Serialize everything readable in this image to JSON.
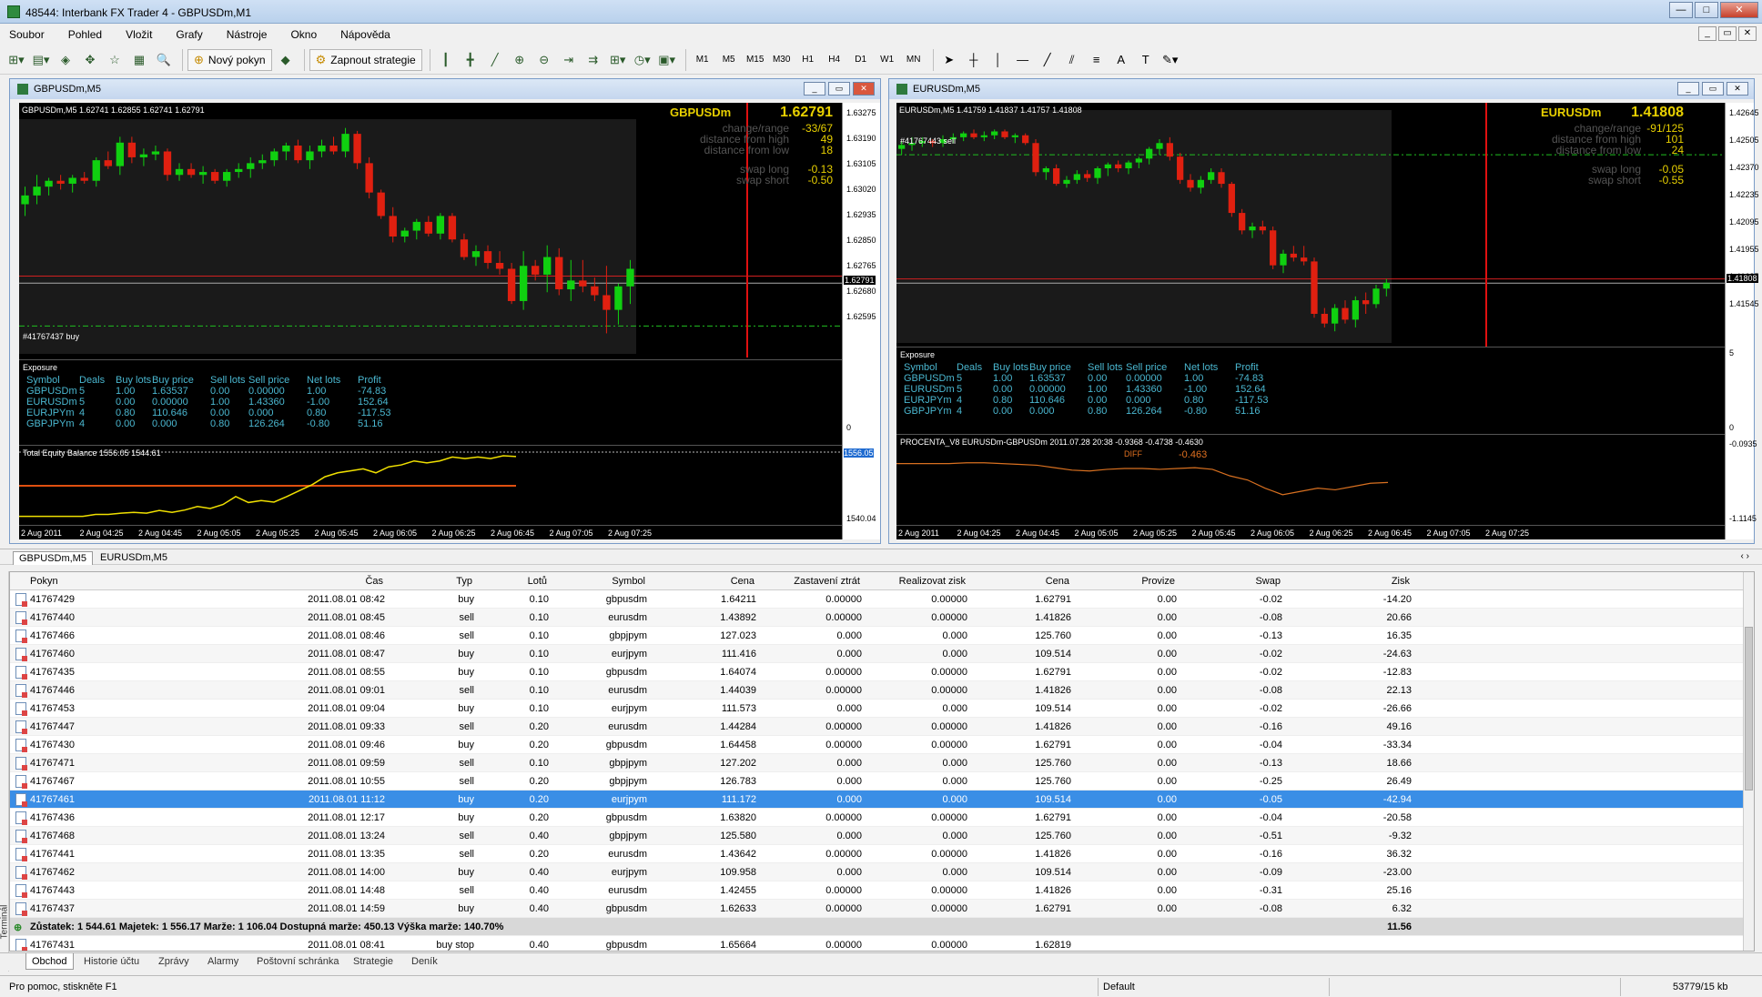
{
  "window": {
    "title": "48544: Interbank FX Trader 4 - GBPUSDm,M1"
  },
  "menu": [
    "Soubor",
    "Pohled",
    "Vložit",
    "Grafy",
    "Nástroje",
    "Okno",
    "Nápověda"
  ],
  "toolbar": {
    "new_order": "Nový pokyn",
    "expert": "Zapnout strategie",
    "timeframes": [
      "M1",
      "M5",
      "M15",
      "M30",
      "H1",
      "H4",
      "D1",
      "W1",
      "MN"
    ]
  },
  "chart1": {
    "title": "GBPUSDm,M5",
    "ohlc": "GBPUSDm,M5  1.62741 1.62855 1.62741 1.62791",
    "symbol": "GBPUSDm",
    "price": "1.62791",
    "order_label": "#41767437 buy",
    "info": [
      [
        "change/range",
        "-33/67"
      ],
      [
        "distance from high",
        "49"
      ],
      [
        "distance from low",
        "18"
      ],
      [
        "swap long",
        "-0.13"
      ],
      [
        "swap short",
        "-0.50"
      ]
    ],
    "yticks": [
      "1.63275",
      "1.63190",
      "1.63105",
      "1.63020",
      "1.62935",
      "1.62850",
      "1.62765",
      "1.62680",
      "1.62595"
    ],
    "yprice_tag": "1.62791",
    "equity_label": "Total Equity Balance 1556.05 1544.61",
    "equity_tag": "1556.05",
    "equity_low": "1540.04",
    "xticks": [
      "2 Aug 2011",
      "2 Aug 04:25",
      "2 Aug 04:45",
      "2 Aug 05:05",
      "2 Aug 05:25",
      "2 Aug 05:45",
      "2 Aug 06:05",
      "2 Aug 06:25",
      "2 Aug 06:45",
      "2 Aug 07:05",
      "2 Aug 07:25"
    ]
  },
  "chart2": {
    "title": "EURUSDm,M5",
    "ohlc": "EURUSDm,M5  1.41759 1.41837 1.41757 1.41808",
    "symbol": "EURUSDm",
    "price": "1.41808",
    "order_label": "#41767443 sell",
    "info": [
      [
        "change/range",
        "-91/125"
      ],
      [
        "distance from high",
        "101"
      ],
      [
        "distance from low",
        "24"
      ],
      [
        "swap long",
        "-0.05"
      ],
      [
        "swap short",
        "-0.55"
      ]
    ],
    "yticks": [
      "1.42645",
      "1.42505",
      "1.42370",
      "1.42235",
      "1.42095",
      "1.41955",
      "1.41685",
      "1.41545"
    ],
    "yprice_tag": "1.41808",
    "indicator_label": "PROCENTA_V8 EURUSDm-GBPUSDm 2011.07.28 20:38  -0.9368 -0.4738 -0.4630",
    "diff_label": "DIFF",
    "diff_value": "-0.463",
    "ind_top": "-0.0935",
    "ind_bottom": "-1.1145",
    "exp_zero": "0",
    "exp_top": "5",
    "xticks": [
      "2 Aug 2011",
      "2 Aug 04:25",
      "2 Aug 04:45",
      "2 Aug 05:05",
      "2 Aug 05:25",
      "2 Aug 05:45",
      "2 Aug 06:05",
      "2 Aug 06:25",
      "2 Aug 06:45",
      "2 Aug 07:05",
      "2 Aug 07:25"
    ]
  },
  "exposure": {
    "title": "Exposure",
    "headers": [
      "Symbol",
      "Deals",
      "Buy lots",
      "Buy price",
      "Sell lots",
      "Sell price",
      "Net lots",
      "Profit"
    ],
    "rows1": [
      [
        "GBPUSDm",
        "5",
        "1.00",
        "1.63537",
        "0.00",
        "0.00000",
        "1.00",
        "-74.83"
      ],
      [
        "EURUSDm",
        "5",
        "0.00",
        "0.00000",
        "1.00",
        "1.43360",
        "-1.00",
        "152.64"
      ],
      [
        "EURJPYm",
        "4",
        "0.80",
        "110.646",
        "0.00",
        "0.000",
        "0.80",
        "-117.53"
      ],
      [
        "GBPJPYm",
        "4",
        "0.00",
        "0.000",
        "0.80",
        "126.264",
        "-0.80",
        "51.16"
      ]
    ],
    "rows2": [
      [
        "GBPUSDm",
        "5",
        "1.00",
        "1.63537",
        "0.00",
        "0.00000",
        "1.00",
        "-74.83"
      ],
      [
        "EURUSDm",
        "5",
        "0.00",
        "0.00000",
        "1.00",
        "1.43360",
        "-1.00",
        "152.64"
      ],
      [
        "EURJPYm",
        "4",
        "0.80",
        "110.646",
        "0.00",
        "0.000",
        "0.80",
        "-117.53"
      ],
      [
        "GBPJPYm",
        "4",
        "0.00",
        "0.000",
        "0.80",
        "126.264",
        "-0.80",
        "51.16"
      ]
    ],
    "zero": "0"
  },
  "chart_tabs": [
    "GBPUSDm,M5",
    "EURUSDm,M5"
  ],
  "terminal": {
    "headers": [
      "Pokyn",
      "Čas",
      "Typ",
      "Lotů",
      "Symbol",
      "Cena",
      "Zastavení ztrát",
      "Realizovat zisk",
      "Cena",
      "Provize",
      "Swap",
      "Zisk"
    ],
    "rows": [
      [
        "41767429",
        "2011.08.01 08:42",
        "buy",
        "0.10",
        "gbpusdm",
        "1.64211",
        "0.00000",
        "0.00000",
        "1.62791",
        "0.00",
        "-0.02",
        "-14.20"
      ],
      [
        "41767440",
        "2011.08.01 08:45",
        "sell",
        "0.10",
        "eurusdm",
        "1.43892",
        "0.00000",
        "0.00000",
        "1.41826",
        "0.00",
        "-0.08",
        "20.66"
      ],
      [
        "41767466",
        "2011.08.01 08:46",
        "sell",
        "0.10",
        "gbpjpym",
        "127.023",
        "0.000",
        "0.000",
        "125.760",
        "0.00",
        "-0.13",
        "16.35"
      ],
      [
        "41767460",
        "2011.08.01 08:47",
        "buy",
        "0.10",
        "eurjpym",
        "111.416",
        "0.000",
        "0.000",
        "109.514",
        "0.00",
        "-0.02",
        "-24.63"
      ],
      [
        "41767435",
        "2011.08.01 08:55",
        "buy",
        "0.10",
        "gbpusdm",
        "1.64074",
        "0.00000",
        "0.00000",
        "1.62791",
        "0.00",
        "-0.02",
        "-12.83"
      ],
      [
        "41767446",
        "2011.08.01 09:01",
        "sell",
        "0.10",
        "eurusdm",
        "1.44039",
        "0.00000",
        "0.00000",
        "1.41826",
        "0.00",
        "-0.08",
        "22.13"
      ],
      [
        "41767453",
        "2011.08.01 09:04",
        "buy",
        "0.10",
        "eurjpym",
        "111.573",
        "0.000",
        "0.000",
        "109.514",
        "0.00",
        "-0.02",
        "-26.66"
      ],
      [
        "41767447",
        "2011.08.01 09:33",
        "sell",
        "0.20",
        "eurusdm",
        "1.44284",
        "0.00000",
        "0.00000",
        "1.41826",
        "0.00",
        "-0.16",
        "49.16"
      ],
      [
        "41767430",
        "2011.08.01 09:46",
        "buy",
        "0.20",
        "gbpusdm",
        "1.64458",
        "0.00000",
        "0.00000",
        "1.62791",
        "0.00",
        "-0.04",
        "-33.34"
      ],
      [
        "41767471",
        "2011.08.01 09:59",
        "sell",
        "0.10",
        "gbpjpym",
        "127.202",
        "0.000",
        "0.000",
        "125.760",
        "0.00",
        "-0.13",
        "18.66"
      ],
      [
        "41767467",
        "2011.08.01 10:55",
        "sell",
        "0.20",
        "gbpjpym",
        "126.783",
        "0.000",
        "0.000",
        "125.760",
        "0.00",
        "-0.25",
        "26.49"
      ],
      [
        "41767461",
        "2011.08.01 11:12",
        "buy",
        "0.20",
        "eurjpym",
        "111.172",
        "0.000",
        "0.000",
        "109.514",
        "0.00",
        "-0.05",
        "-42.94"
      ],
      [
        "41767436",
        "2011.08.01 12:17",
        "buy",
        "0.20",
        "gbpusdm",
        "1.63820",
        "0.00000",
        "0.00000",
        "1.62791",
        "0.00",
        "-0.04",
        "-20.58"
      ],
      [
        "41767468",
        "2011.08.01 13:24",
        "sell",
        "0.40",
        "gbpjpym",
        "125.580",
        "0.000",
        "0.000",
        "125.760",
        "0.00",
        "-0.51",
        "-9.32"
      ],
      [
        "41767441",
        "2011.08.01 13:35",
        "sell",
        "0.20",
        "eurusdm",
        "1.43642",
        "0.00000",
        "0.00000",
        "1.41826",
        "0.00",
        "-0.16",
        "36.32"
      ],
      [
        "41767462",
        "2011.08.01 14:00",
        "buy",
        "0.40",
        "eurjpym",
        "109.958",
        "0.000",
        "0.000",
        "109.514",
        "0.00",
        "-0.09",
        "-23.00"
      ],
      [
        "41767443",
        "2011.08.01 14:48",
        "sell",
        "0.40",
        "eurusdm",
        "1.42455",
        "0.00000",
        "0.00000",
        "1.41826",
        "0.00",
        "-0.31",
        "25.16"
      ],
      [
        "41767437",
        "2011.08.01 14:59",
        "buy",
        "0.40",
        "gbpusdm",
        "1.62633",
        "0.00000",
        "0.00000",
        "1.62791",
        "0.00",
        "-0.08",
        "6.32"
      ]
    ],
    "summary": "Zůstatek: 1 544.61  Majetek: 1 556.17  Marže: 1 106.04  Dostupná marže: 450.13  Výška marže: 140.70%",
    "summary_total": "11.56",
    "pending": [
      "41767431",
      "2011.08.01 08:41",
      "buy stop",
      "0.40",
      "gbpusdm",
      "1.65664",
      "0.00000",
      "0.00000",
      "1.62819",
      "",
      "",
      ""
    ]
  },
  "bottom_tabs": [
    "Obchod",
    "Historie účtu",
    "Zprávy",
    "Alarmy",
    "Poštovní schránka",
    "Strategie",
    "Deník"
  ],
  "side_label": "Terminál",
  "status": {
    "help": "Pro pomoc, stiskněte F1",
    "profile": "Default",
    "traffic": "53779/15 kb"
  }
}
